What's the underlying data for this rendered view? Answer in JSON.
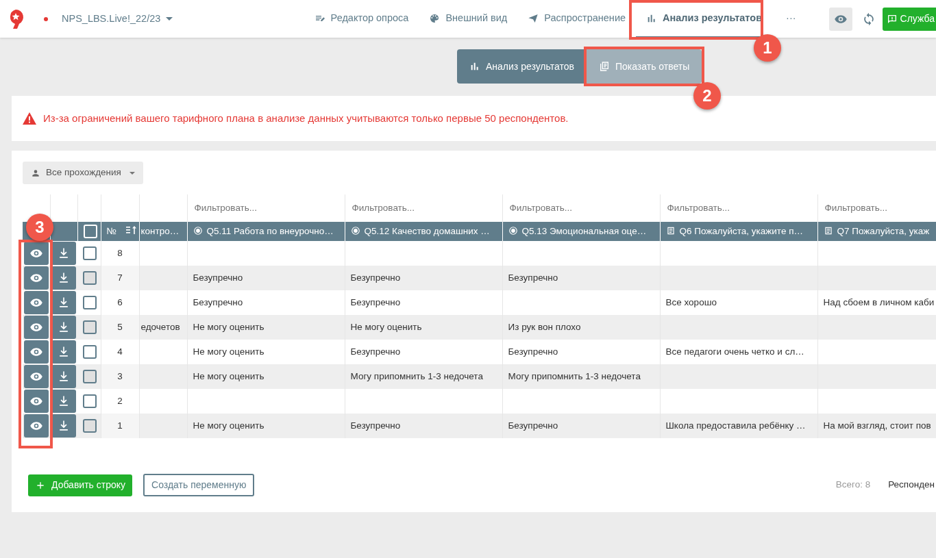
{
  "topbar": {
    "project": "NPS_LBS.Live!_22/23",
    "tabs": [
      {
        "label": "Редактор опроса",
        "selected": false
      },
      {
        "label": "Внешний вид",
        "selected": false
      },
      {
        "label": "Распространение",
        "selected": false
      },
      {
        "label": "Анализ результатов",
        "selected": true
      }
    ],
    "more": "···",
    "service_button": "Служба"
  },
  "view_switch": [
    {
      "label": "Анализ результатов",
      "selected": false
    },
    {
      "label": "Показать ответы",
      "selected": true
    }
  ],
  "alert": "Из-за ограничений вашего тарифного плана в анализе данных учитываются только первые 50 респондентов.",
  "filter_dropdown": "Все прохождения",
  "table": {
    "number_header": "№",
    "select_all_checked": false,
    "columns": [
      {
        "label": "контро…",
        "kind": "partial"
      },
      {
        "label": "Q5.11 Работа по внеурочно…",
        "kind": "choice",
        "filter_placeholder": "Фильтровать..."
      },
      {
        "label": "Q5.12 Качество домашних …",
        "kind": "choice",
        "filter_placeholder": "Фильтровать..."
      },
      {
        "label": "Q5.13 Эмоциональная оце…",
        "kind": "choice",
        "filter_placeholder": "Фильтровать..."
      },
      {
        "label": "Q6 Пожалуйста, укажите п…",
        "kind": "text",
        "filter_placeholder": "Фильтровать..."
      },
      {
        "label": "Q7 Пожалуйста, укаж",
        "kind": "text",
        "filter_placeholder": "Фильтровать..."
      }
    ],
    "rows": [
      {
        "number": "8",
        "checked": false,
        "cells": [
          "",
          "",
          "",
          "",
          "",
          ""
        ]
      },
      {
        "number": "7",
        "checked": false,
        "cells": [
          "",
          "Безупречно",
          "Безупречно",
          "Безупречно",
          "",
          ""
        ]
      },
      {
        "number": "6",
        "checked": false,
        "cells": [
          "",
          "Безупречно",
          "Безупречно",
          "",
          "Все хорошо",
          "Над сбоем в личном каби"
        ]
      },
      {
        "number": "5",
        "checked": false,
        "cells": [
          "едочетов",
          "Не могу оценить",
          "Не могу оценить",
          "Из рук вон плохо",
          "",
          ""
        ]
      },
      {
        "number": "4",
        "checked": false,
        "cells": [
          "",
          "Не могу оценить",
          "Безупречно",
          "Безупречно",
          "Все педагоги очень четко и сл…",
          ""
        ]
      },
      {
        "number": "3",
        "checked": false,
        "cells": [
          "",
          "Не могу оценить",
          "Могу припомнить 1-3 недочета",
          "Могу припомнить 1-3 недочета",
          "",
          ""
        ]
      },
      {
        "number": "2",
        "checked": false,
        "cells": [
          "",
          "",
          "",
          "",
          "",
          ""
        ]
      },
      {
        "number": "1",
        "checked": false,
        "cells": [
          "",
          "Не могу оценить",
          "Безупречно",
          "Безупречно",
          "Школа предоставила ребёнку …",
          "На мой взгляд, стоит пов"
        ]
      }
    ]
  },
  "footer": {
    "add_row_button": "Добавить строку",
    "create_variable_button": "Создать переменную",
    "total": "Всего: 8",
    "respondents": "Респонден"
  },
  "callouts": [
    {
      "number": "1"
    },
    {
      "number": "2"
    },
    {
      "number": "3"
    }
  ]
}
